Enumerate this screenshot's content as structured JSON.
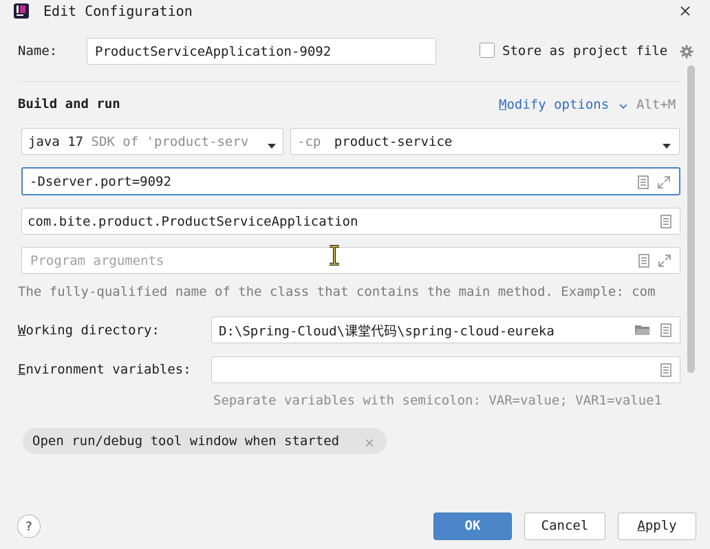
{
  "window": {
    "title": "Edit Configuration"
  },
  "name_row": {
    "label": "Name:",
    "value": "ProductServiceApplication-9092",
    "store_label": "Store as project file"
  },
  "section": {
    "title": "Build and run",
    "modify_options": "Modify options",
    "shortcut": "Alt+M"
  },
  "jdk": {
    "bold": "java 17",
    "rest": " SDK of 'product-serv"
  },
  "classpath": {
    "prefix": "-cp",
    "module": "product-service"
  },
  "vm_options": {
    "value": "-Dserver.port=9092"
  },
  "main_class": {
    "value": "com.bite.product.ProductServiceApplication"
  },
  "program_args": {
    "placeholder": "Program arguments"
  },
  "hint": {
    "text": "The fully-qualified name of the class that contains the main method. Example: com"
  },
  "working_dir": {
    "label": "Working directory:",
    "value": "D:\\Spring-Cloud\\课堂代码\\spring-cloud-eureka"
  },
  "env": {
    "label": "Environment variables:",
    "hint": "Separate variables with semicolon: VAR=value; VAR1=value1"
  },
  "chip": {
    "label": "Open run/debug tool window when started"
  },
  "footer": {
    "help": "?",
    "ok": "OK",
    "cancel": "Cancel",
    "apply": "Apply"
  },
  "colors": {
    "accent": "#4a86c8",
    "link": "#2f6fbf",
    "focus": "#4a86c8"
  }
}
